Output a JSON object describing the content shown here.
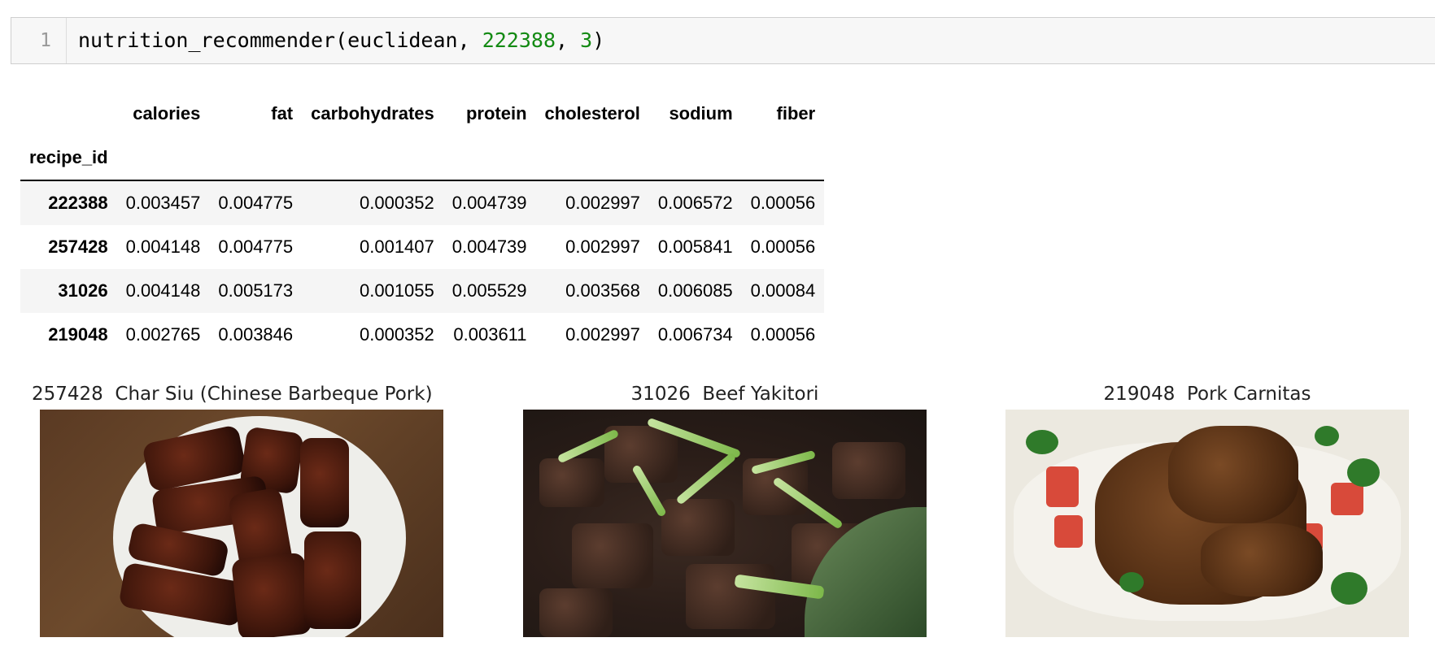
{
  "cell": {
    "line_number": "1",
    "code_prefix": "nutrition_recommender(euclidean, ",
    "arg_id": "222388",
    "arg_sep": ", ",
    "arg_n": "3",
    "code_suffix": ")"
  },
  "dataframe": {
    "columns": [
      "calories",
      "fat",
      "carbohydrates",
      "protein",
      "cholesterol",
      "sodium",
      "fiber"
    ],
    "index_name": "recipe_id",
    "rows": [
      {
        "id": "222388",
        "values": [
          "0.003457",
          "0.004775",
          "0.000352",
          "0.004739",
          "0.002997",
          "0.006572",
          "0.00056"
        ]
      },
      {
        "id": "257428",
        "values": [
          "0.004148",
          "0.004775",
          "0.001407",
          "0.004739",
          "0.002997",
          "0.005841",
          "0.00056"
        ]
      },
      {
        "id": "31026",
        "values": [
          "0.004148",
          "0.005173",
          "0.001055",
          "0.005529",
          "0.003568",
          "0.006085",
          "0.00084"
        ]
      },
      {
        "id": "219048",
        "values": [
          "0.002765",
          "0.003846",
          "0.000352",
          "0.003611",
          "0.002997",
          "0.006734",
          "0.00056"
        ]
      }
    ]
  },
  "recipes": [
    {
      "title": "257428  Char Siu (Chinese Barbeque Pork)"
    },
    {
      "title": "31026  Beef Yakitori"
    },
    {
      "title": "219048  Pork Carnitas"
    }
  ]
}
